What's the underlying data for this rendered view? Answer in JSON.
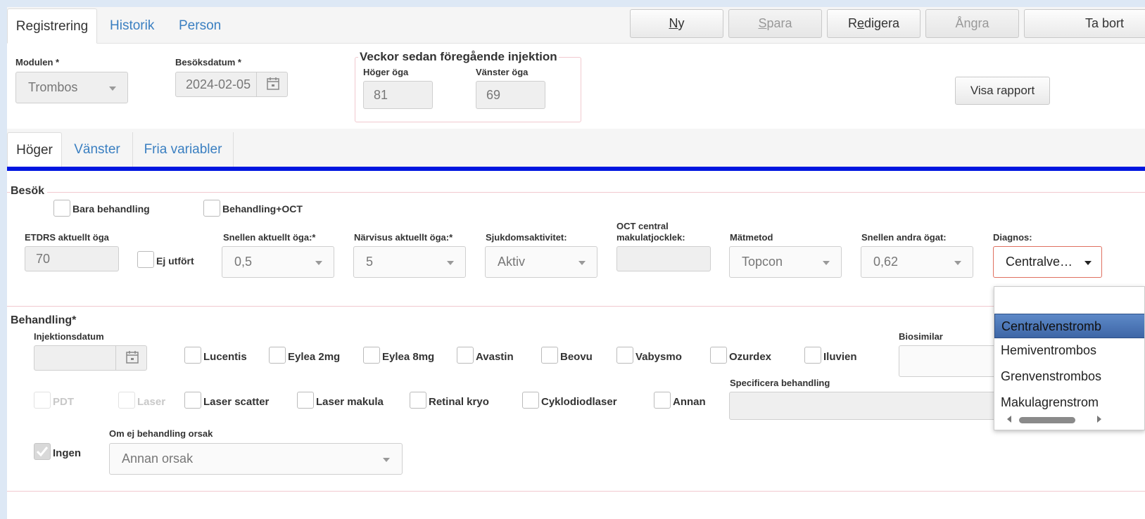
{
  "top_tabs": [
    "Registrering",
    "Historik",
    "Person"
  ],
  "toolbar": {
    "ny": {
      "prefix": "",
      "ul": "N",
      "rest": "y"
    },
    "spara": {
      "prefix": "",
      "ul": "S",
      "rest": "para"
    },
    "redigera": {
      "prefix": "R",
      "ul": "e",
      "rest": "digera"
    },
    "angra": "Ångra",
    "ta_bort": "Ta bort"
  },
  "header": {
    "modulen_label": "Modulen *",
    "modulen_value": "Trombos",
    "besoksdatum_label": "Besöksdatum *",
    "besoksdatum_value": "2024-02-05",
    "weeks_title": "Veckor sedan föregående injektion",
    "hoger_label": "Höger öga",
    "hoger_value": "81",
    "vanster_label": "Vänster öga",
    "vanster_value": "69",
    "visa_rapport": "Visa rapport"
  },
  "sub_tabs": [
    "Höger",
    "Vänster",
    "Fria variabler"
  ],
  "colors": {
    "accent_bar": "#0016e0",
    "link": "#3a7fc1",
    "fieldset_border": "#f1c9cf"
  },
  "besok": {
    "legend": "Besök",
    "bara_behandling": "Bara behandling",
    "behandling_oct": "Behandling+OCT",
    "etdrs_label": "ETDRS aktuellt öga",
    "etdrs_value": "70",
    "ej_utfort": "Ej utfört",
    "snellen_label": "Snellen aktuellt öga:*",
    "snellen_value": "0,5",
    "narvisus_label": "Närvisus aktuellt öga:*",
    "narvisus_value": "5",
    "sjukdom_label": "Sjukdomsaktivitet:",
    "sjukdom_value": "Aktiv",
    "oct_label_1": "OCT central",
    "oct_label_2": "makulatjocklek:",
    "oct_value": "",
    "matmetod_label": "Mätmetod",
    "matmetod_value": "Topcon",
    "snellen_andra_label": "Snellen andra ögat:",
    "snellen_andra_value": "0,62",
    "diagnos_label": "Diagnos:",
    "diagnos_value": "Centralve…"
  },
  "diagnos_options": [
    "Centralvenstromb",
    "Hemiventrombos",
    "Grenvenstrombos",
    "Makulagrenstrom"
  ],
  "behandling": {
    "legend": "Behandling*",
    "injektionsdatum_label": "Injektionsdatum",
    "injektionsdatum_value": "",
    "drugs": [
      "Lucentis",
      "Eylea 2mg",
      "Eylea 8mg",
      "Avastin",
      "Beovu",
      "Vabysmo",
      "Ozurdex",
      "Iluvien"
    ],
    "biosimilar_label": "Biosimilar",
    "procedures": [
      "PDT",
      "Laser",
      "Laser scatter",
      "Laser makula",
      "Retinal kryo",
      "Cyklodiodlaser",
      "Annan"
    ],
    "specificera_label": "Specificera behandling",
    "ingen": "Ingen",
    "om_ej_label": "Om ej behandling orsak",
    "om_ej_value": "Annan orsak"
  }
}
